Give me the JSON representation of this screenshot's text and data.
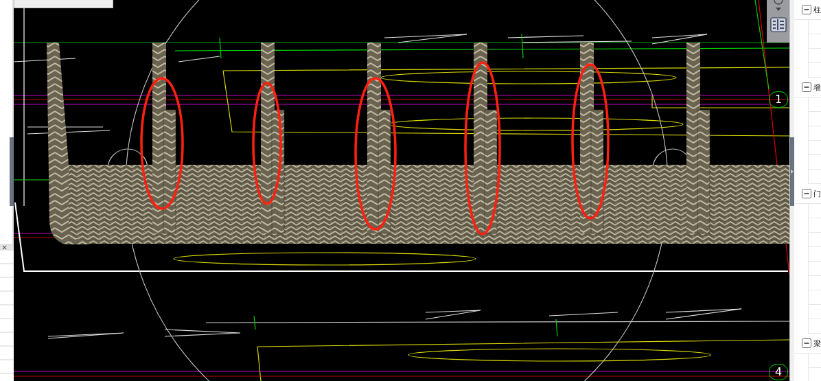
{
  "viewport": {
    "axis_markers": [
      {
        "label": "1"
      },
      {
        "label": "4"
      }
    ]
  },
  "tree_panel": {
    "groups": [
      {
        "label": "柱",
        "expanded": true
      },
      {
        "label": "墙",
        "expanded": true
      },
      {
        "label": "门",
        "expanded": true
      },
      {
        "label": "梁",
        "expanded": true
      }
    ]
  }
}
